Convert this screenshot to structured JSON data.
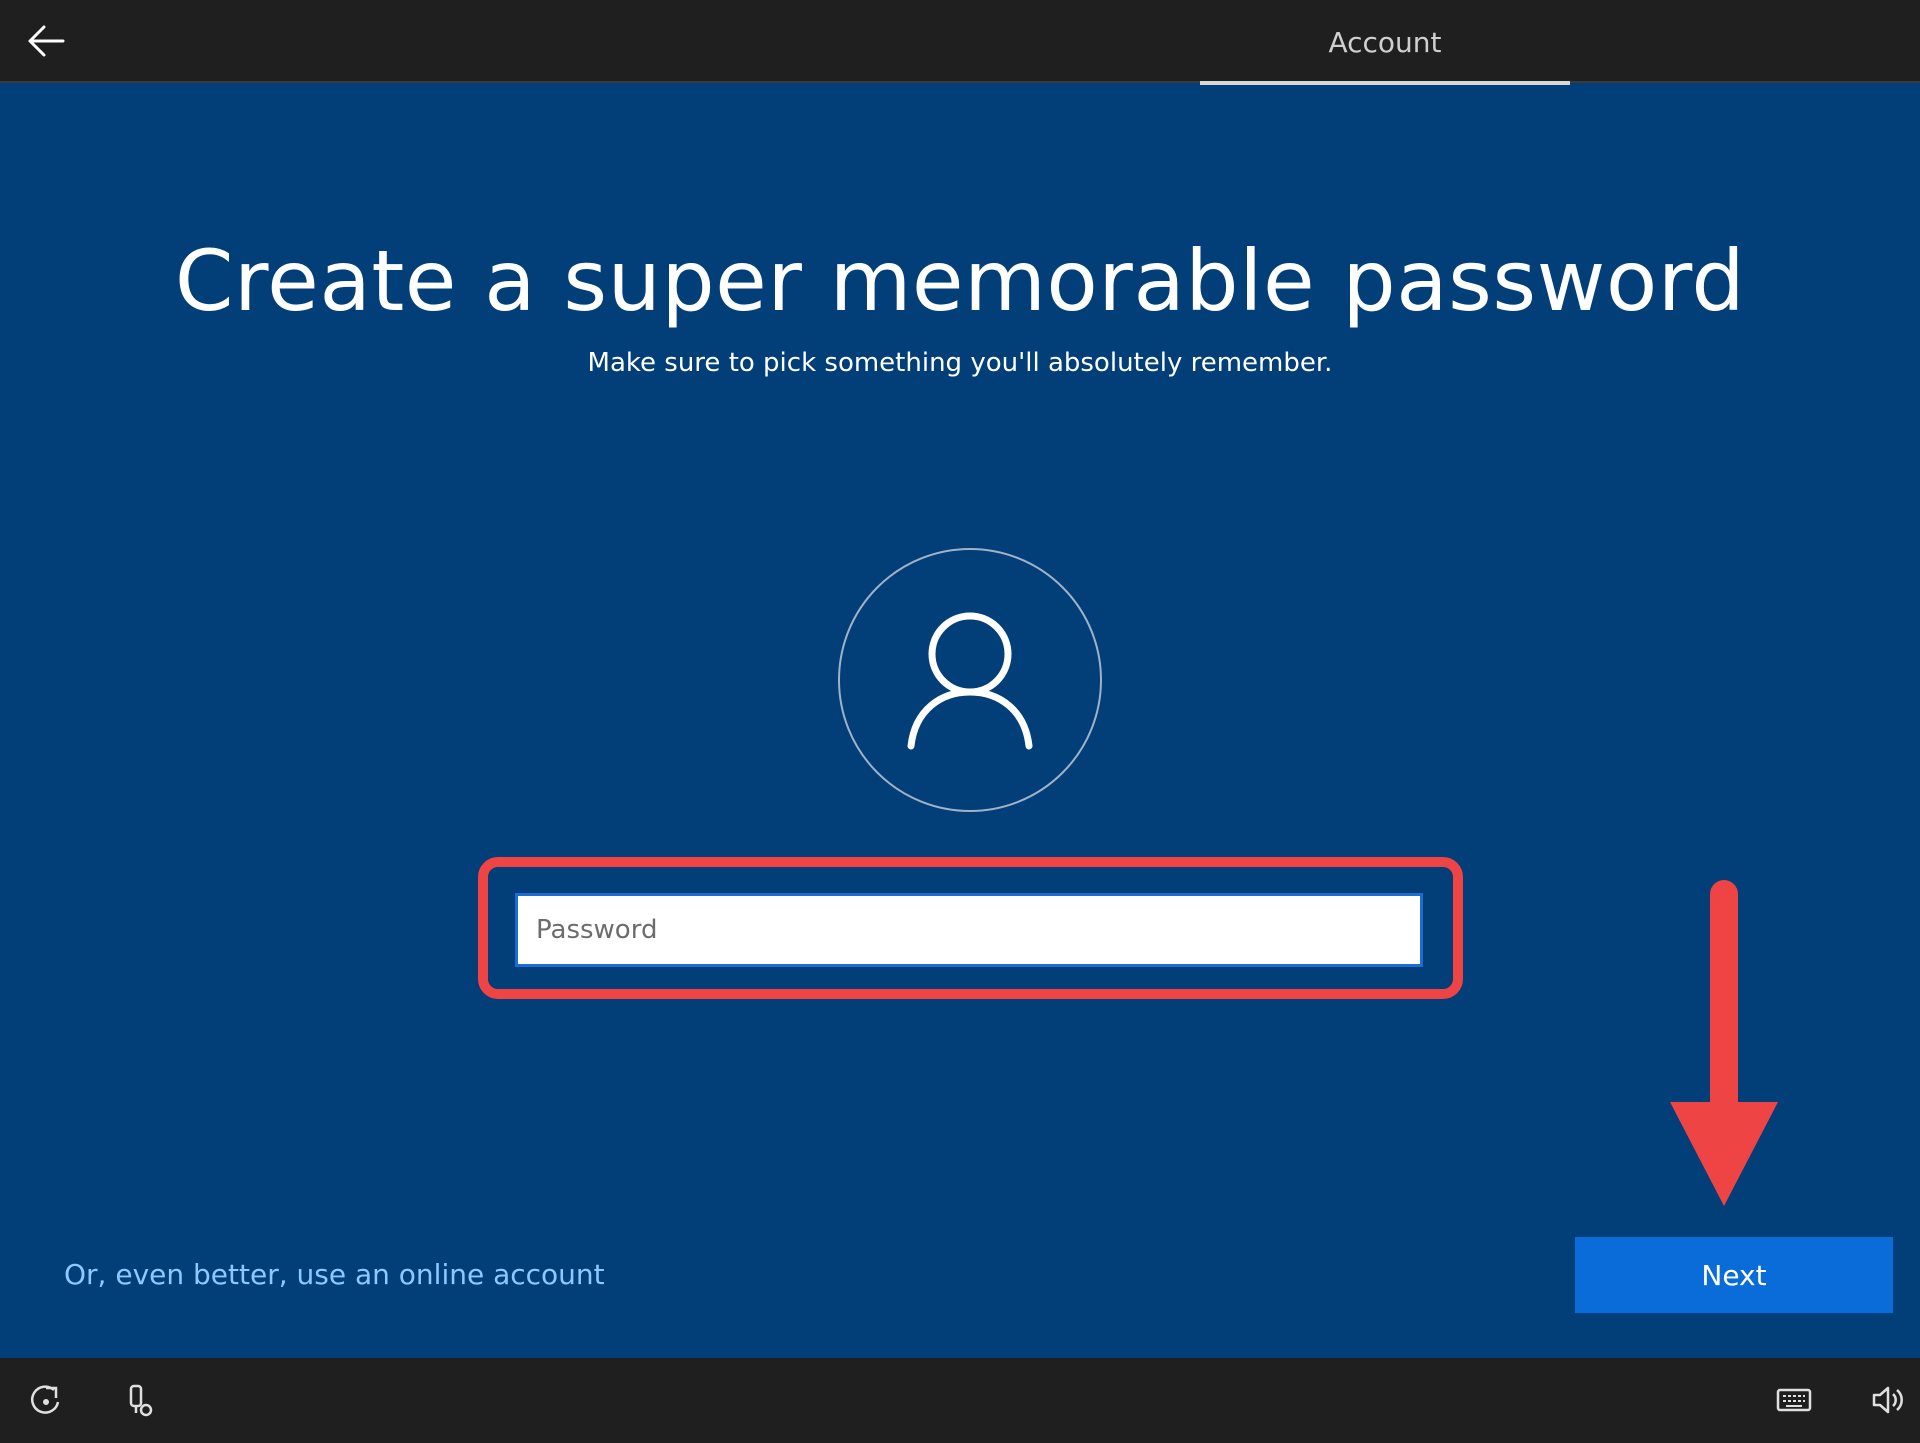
{
  "header": {
    "back_icon": "arrow-left-icon",
    "tab_label": "Account"
  },
  "main": {
    "title": "Create a super memorable password",
    "subtitle": "Make sure to pick something you'll absolutely remember.",
    "avatar_icon": "user-icon",
    "password": {
      "placeholder": "Password",
      "value": ""
    },
    "annotation": {
      "highlight_color": "#ef4444",
      "arrow_icon": "arrow-down-icon"
    }
  },
  "footer": {
    "online_account_link": "Or, even better, use an online account",
    "next_label": "Next"
  },
  "bottom_bar": {
    "left_icons": [
      "ease-of-access-icon",
      "device-microphone-icon"
    ],
    "right_icons": [
      "keyboard-icon",
      "volume-icon"
    ]
  },
  "colors": {
    "background": "#023e78",
    "bar_background": "#1f1f1f",
    "accent": "#0a6cd8",
    "link": "#8ec8ff"
  }
}
